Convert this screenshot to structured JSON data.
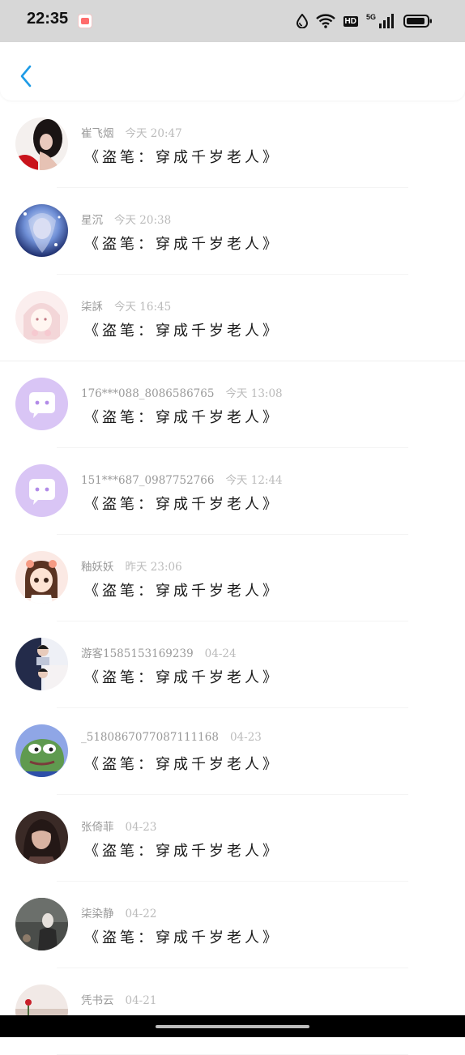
{
  "status_bar": {
    "time": "22:35",
    "hd": "HD",
    "network": "5G"
  },
  "rows": [
    {
      "name": "崔飞烟",
      "time": "今天 20:47",
      "comment": "《盗笔：穿成千岁老人》",
      "avatar": "photo-dark"
    },
    {
      "name": "星沉",
      "time": "今天 20:38",
      "comment": "《盗笔：穿成千岁老人》",
      "avatar": "photo-blue"
    },
    {
      "name": "柒訸",
      "time": "今天 16:45",
      "comment": "《盗笔：穿成千岁老人》",
      "avatar": "photo-pink"
    },
    {
      "name": "176***088_8086586765",
      "time": "今天 13:08",
      "comment": "《盗笔：穿成千岁老人》",
      "avatar": "default-purple"
    },
    {
      "name": "151***687_0987752766",
      "time": "今天 12:44",
      "comment": "《盗笔：穿成千岁老人》",
      "avatar": "default-purple"
    },
    {
      "name": "釉妖妖",
      "time": "昨天 23:06",
      "comment": "《盗笔：穿成千岁老人》",
      "avatar": "photo-cartoon"
    },
    {
      "name": "游客1585153169239",
      "time": "04-24",
      "comment": "《盗笔：穿成千岁老人》",
      "avatar": "photo-collage"
    },
    {
      "name": "_5180867077087111168",
      "time": "04-23",
      "comment": "《盗笔：穿成千岁老人》",
      "avatar": "photo-frog"
    },
    {
      "name": "张倚菲",
      "time": "04-23",
      "comment": "《盗笔：穿成千岁老人》",
      "avatar": "photo-woman"
    },
    {
      "name": "柒染静",
      "time": "04-22",
      "comment": "《盗笔：穿成千岁老人》",
      "avatar": "photo-gray"
    },
    {
      "name": "凭书云",
      "time": "04-21",
      "comment": "",
      "avatar": "photo-rose"
    }
  ],
  "colors": {
    "accent": "#1e9be6",
    "default_avatar_bg": "#d9c5f5",
    "default_avatar_fg": "#b28be8"
  }
}
